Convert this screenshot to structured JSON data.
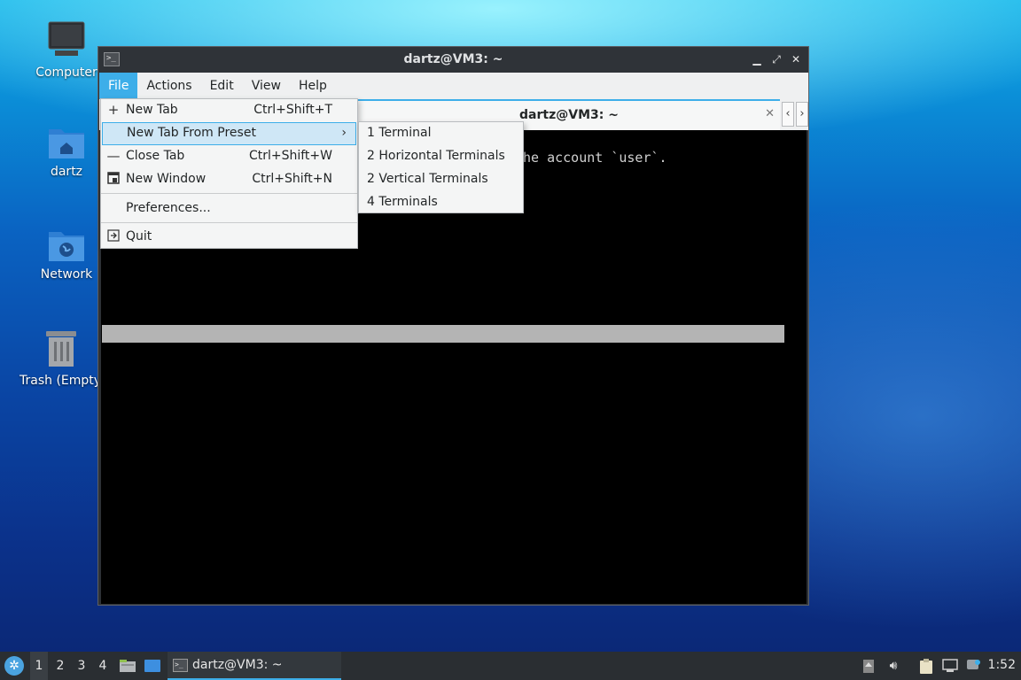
{
  "desktop": {
    "icons": [
      {
        "label": "Computer",
        "icon": "computer-icon"
      },
      {
        "label": "dartz",
        "icon": "home-folder-icon"
      },
      {
        "label": "Network",
        "icon": "network-folder-icon"
      },
      {
        "label": "Trash (Empty)",
        "icon": "trash-icon"
      }
    ]
  },
  "window": {
    "title": "dartz@VM3: ~",
    "menubar": [
      "File",
      "Actions",
      "Edit",
      "View",
      "Help"
    ],
    "tab": {
      "title": "dartz@VM3: ~"
    },
    "terminal": {
      "visible_text": "he account `user`."
    }
  },
  "file_menu": {
    "items": [
      {
        "label": "New Tab",
        "shortcut": "Ctrl+Shift+T",
        "icon": "plus-icon"
      },
      {
        "label": "New Tab From Preset",
        "shortcut": "",
        "submenu": true
      },
      {
        "label": "Close Tab",
        "shortcut": "Ctrl+Shift+W",
        "icon": "minus-icon"
      },
      {
        "label": "New Window",
        "shortcut": "Ctrl+Shift+N",
        "icon": "new-window-icon"
      },
      {
        "label": "Preferences...",
        "shortcut": ""
      },
      {
        "label": "Quit",
        "shortcut": "",
        "icon": "quit-icon"
      }
    ]
  },
  "preset_submenu": {
    "items": [
      "1 Terminal",
      "2 Horizontal Terminals",
      "2 Vertical Terminals",
      "4 Terminals"
    ]
  },
  "taskbar": {
    "workspaces": [
      "1",
      "2",
      "3",
      "4"
    ],
    "task_label": "dartz@VM3: ~",
    "clock": "1:52"
  },
  "colors": {
    "accent": "#3daee9",
    "menu_bg": "#f4f5f5",
    "terminal_bg": "#000000",
    "taskbar_bg": "#2a2e32"
  }
}
